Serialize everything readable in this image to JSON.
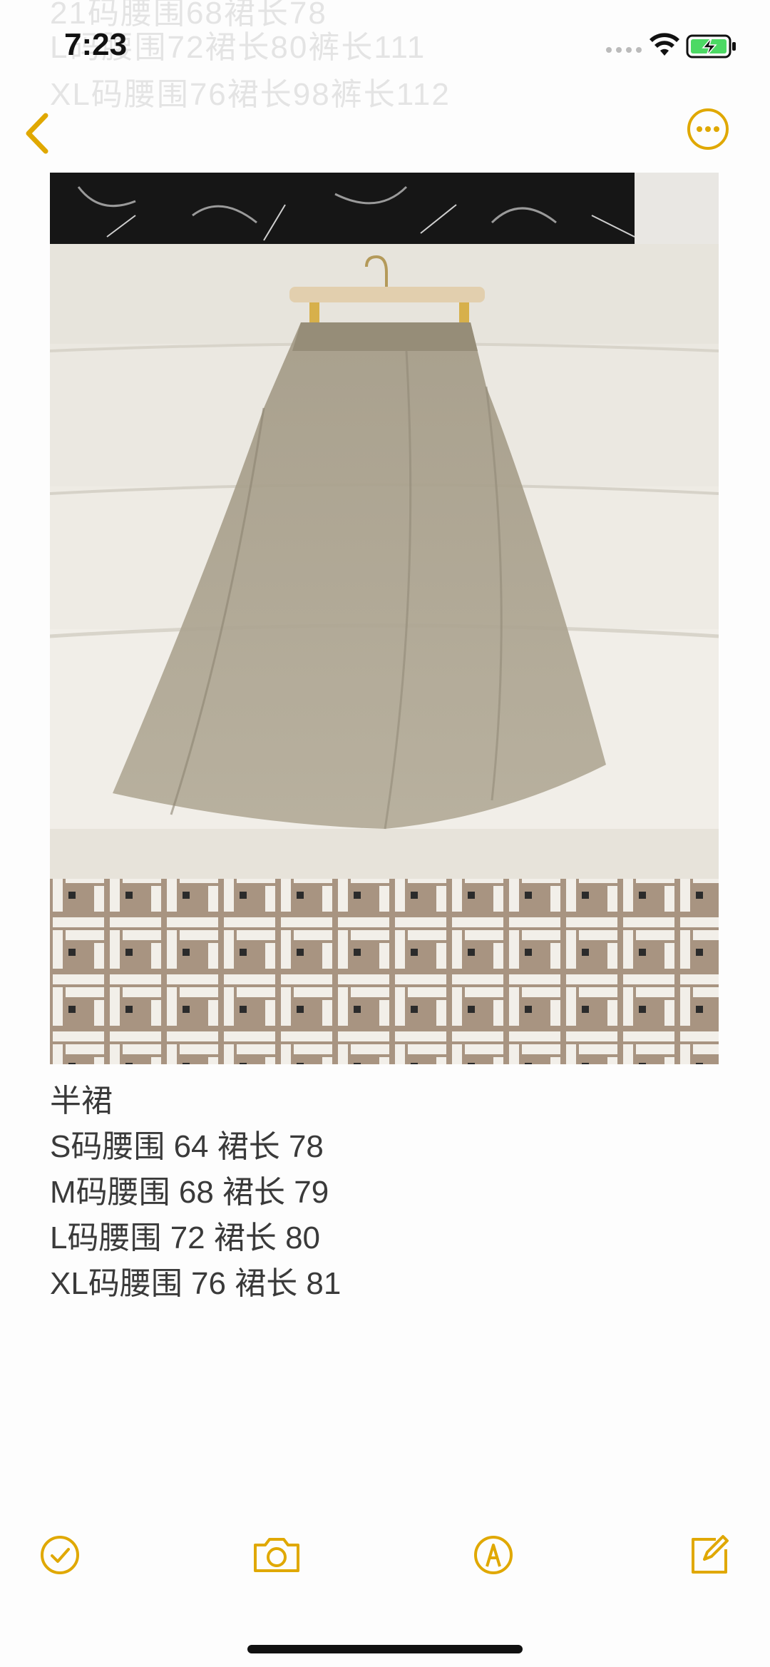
{
  "status_bar": {
    "time": "7:23",
    "background_ghost_text": [
      "21码腰围68裙长78",
      "L码腰围72裙长80裤长111",
      "XL码腰围76裙长98裤长112"
    ]
  },
  "colors": {
    "accent": "#e0a800",
    "text": "#3a3a3a",
    "battery_fill": "#4cd964"
  },
  "nav": {
    "back_icon": "chevron-left-icon",
    "more_icon": "ellipsis-circle-icon"
  },
  "note": {
    "image": {
      "description_icon": "photo-skirt-on-hanger"
    },
    "lines": [
      "半裙",
      "S码腰围 64 裙长 78",
      "M码腰围 68 裙长 79",
      "L码腰围 72 裙长 80",
      "XL码腰围 76 裙长 81"
    ]
  },
  "toolbar": {
    "items": [
      "checklist-icon",
      "camera-icon",
      "markup-icon",
      "compose-icon"
    ]
  }
}
